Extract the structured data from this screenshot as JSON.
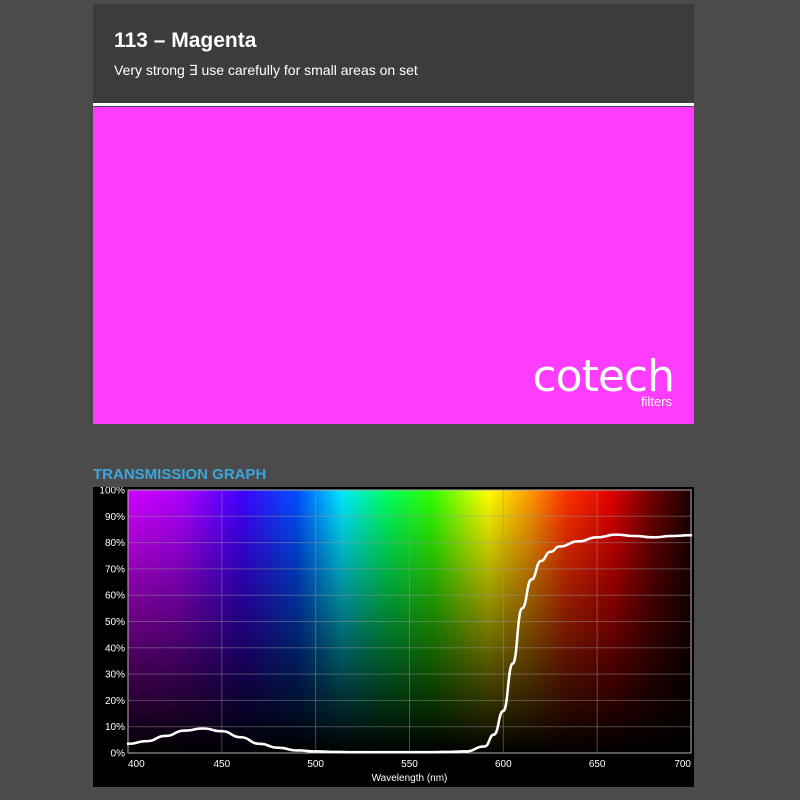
{
  "header": {
    "title": "113 – Magenta",
    "subtitle": "Very strong ∃ use carefully for small areas on set"
  },
  "swatch": {
    "color": "#fd3cfd"
  },
  "logo": {
    "name": "cotech",
    "sub": "filters"
  },
  "section": {
    "heading": "TRANSMISSION GRAPH"
  },
  "colors": {
    "heading": "#3aa6dc",
    "curve": "#ffffff",
    "header_bg": "#3c3c3c",
    "page_bg": "#4b4b4b"
  },
  "chart_data": {
    "type": "line",
    "title": "",
    "xlabel": "Wavelength (nm)",
    "ylabel": "",
    "xlim": [
      400,
      700
    ],
    "ylim": [
      0,
      100
    ],
    "x_ticks": [
      400,
      450,
      500,
      550,
      600,
      650,
      700
    ],
    "y_ticks": [
      0,
      10,
      20,
      30,
      40,
      50,
      60,
      70,
      80,
      90,
      100
    ],
    "x_tick_labels": [
      "400",
      "450",
      "500",
      "550",
      "600",
      "650",
      "700"
    ],
    "y_tick_labels": [
      "0%",
      "10%",
      "20%",
      "30%",
      "40%",
      "50%",
      "60%",
      "70%",
      "80%",
      "90%",
      "100%"
    ],
    "grid": true,
    "background": "visible spectrum",
    "series": [
      {
        "x": [
          400,
          410,
          420,
          430,
          440,
          450,
          460,
          470,
          480,
          490,
          500,
          510,
          520,
          530,
          540,
          550,
          560,
          570,
          580,
          590,
          595,
          600,
          605,
          610,
          615,
          620,
          625,
          630,
          640,
          650,
          660,
          670,
          680,
          690,
          700
        ],
        "y": [
          3.5,
          4.5,
          6.5,
          8.5,
          9.3,
          8.3,
          6,
          3.5,
          2,
          1,
          0.6,
          0.4,
          0.3,
          0.3,
          0.3,
          0.3,
          0.3,
          0.4,
          0.6,
          2.5,
          7,
          16,
          34,
          55,
          66,
          73,
          76.5,
          78.5,
          80.5,
          82,
          83,
          82.5,
          82,
          82.5,
          82.8
        ]
      }
    ]
  }
}
